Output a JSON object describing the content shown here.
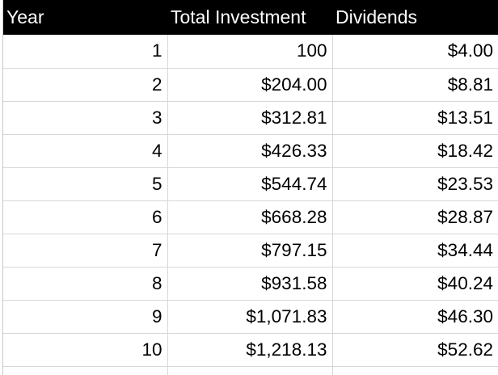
{
  "table": {
    "columns": [
      "Year",
      "Total Investment",
      "Dividends"
    ],
    "rows": [
      {
        "year": "1",
        "investment": "100",
        "dividends": "$4.00"
      },
      {
        "year": "2",
        "investment": "$204.00",
        "dividends": "$8.81"
      },
      {
        "year": "3",
        "investment": "$312.81",
        "dividends": "$13.51"
      },
      {
        "year": "4",
        "investment": "$426.33",
        "dividends": "$18.42"
      },
      {
        "year": "5",
        "investment": "$544.74",
        "dividends": "$23.53"
      },
      {
        "year": "6",
        "investment": "$668.28",
        "dividends": "$28.87"
      },
      {
        "year": "7",
        "investment": "$797.15",
        "dividends": "$34.44"
      },
      {
        "year": "8",
        "investment": "$931.58",
        "dividends": "$40.24"
      },
      {
        "year": "9",
        "investment": "$1,071.83",
        "dividends": "$46.30"
      },
      {
        "year": "10",
        "investment": "$1,218.13",
        "dividends": "$52.62"
      }
    ]
  },
  "colors": {
    "header_bg": "#000000",
    "header_text": "#ffffff",
    "gridline": "#d7d7d7"
  }
}
